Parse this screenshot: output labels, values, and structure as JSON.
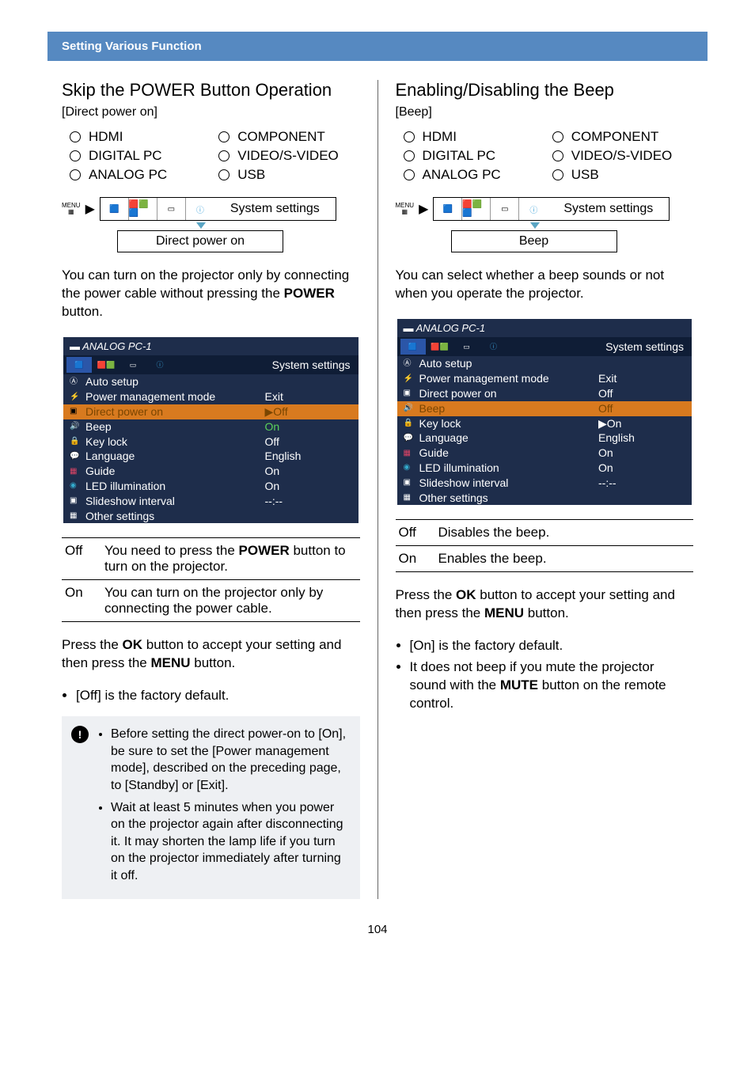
{
  "section_header": "Setting Various Function",
  "page_number": "104",
  "inputs": [
    "HDMI",
    "COMPONENT",
    "DIGITAL PC",
    "VIDEO/S-VIDEO",
    "ANALOG PC",
    "USB"
  ],
  "nav": {
    "tab_system": "System settings",
    "menu_label": "MENU"
  },
  "left": {
    "title": "Skip the POWER Button Operation",
    "subtitle": "[Direct power on]",
    "sub_box": "Direct power on",
    "para1_a": "You can turn on the projector only by connecting the power cable without pressing the ",
    "para1_b": "POWER",
    "para1_c": " button.",
    "osd": {
      "source": "ANALOG PC-1",
      "system": "System settings",
      "rows": [
        {
          "label": "Auto setup",
          "value": ""
        },
        {
          "label": "Power management mode",
          "value": "Exit"
        },
        {
          "label": "Direct power on",
          "value": "▶Off",
          "sel": true
        },
        {
          "label": "Beep",
          "value": "On",
          "green": true
        },
        {
          "label": "Key lock",
          "value": "Off"
        },
        {
          "label": "Language",
          "value": "English"
        },
        {
          "label": "Guide",
          "value": "On"
        },
        {
          "label": "LED illumination",
          "value": "On"
        },
        {
          "label": "Slideshow interval",
          "value": "--:--"
        },
        {
          "label": "Other settings",
          "value": ""
        }
      ]
    },
    "options": [
      {
        "k": "Off",
        "v_a": "You need to press the ",
        "v_b": "POWER",
        "v_c": " button to turn on the projector."
      },
      {
        "k": "On",
        "v_a": "You can turn on the projector only by connecting the power cable.",
        "v_b": "",
        "v_c": ""
      }
    ],
    "press_a": "Press the ",
    "press_b": "OK",
    "press_c": " button to accept your setting and then press the ",
    "press_d": "MENU",
    "press_e": " button.",
    "bullet1": "[Off] is the factory default.",
    "note1": "Before setting the direct power-on to [On], be sure to set the [Power management mode], described on the preceding page, to [Standby] or [Exit].",
    "note2": "Wait at least 5 minutes when you power on the projector again after disconnecting it. It may shorten the lamp life if you turn on the projector immediately after turning it off."
  },
  "right": {
    "title": "Enabling/Disabling the Beep",
    "subtitle": "[Beep]",
    "sub_box": "Beep",
    "para1": "You can select whether a beep sounds or not when you operate the projector.",
    "osd": {
      "source": "ANALOG PC-1",
      "system": "System settings",
      "rows": [
        {
          "label": "Auto setup",
          "value": ""
        },
        {
          "label": "Power management mode",
          "value": "Exit"
        },
        {
          "label": "Direct power on",
          "value": "Off"
        },
        {
          "label": "Beep",
          "value": "Off",
          "sel": true,
          "orange": true
        },
        {
          "label": "Key lock",
          "value": "▶On"
        },
        {
          "label": "Language",
          "value": "English"
        },
        {
          "label": "Guide",
          "value": "On"
        },
        {
          "label": "LED illumination",
          "value": "On"
        },
        {
          "label": "Slideshow interval",
          "value": "--:--"
        },
        {
          "label": "Other settings",
          "value": ""
        }
      ]
    },
    "options": [
      {
        "k": "Off",
        "v": "Disables the beep."
      },
      {
        "k": "On",
        "v": "Enables the beep."
      }
    ],
    "press_a": "Press the ",
    "press_b": "OK",
    "press_c": " button to accept your setting and then press the ",
    "press_d": "MENU",
    "press_e": " button.",
    "bullet1": "[On] is the factory default.",
    "bullet2_a": "It does not beep if you mute the projector sound with the ",
    "bullet2_b": "MUTE",
    "bullet2_c": " button on the remote control."
  }
}
